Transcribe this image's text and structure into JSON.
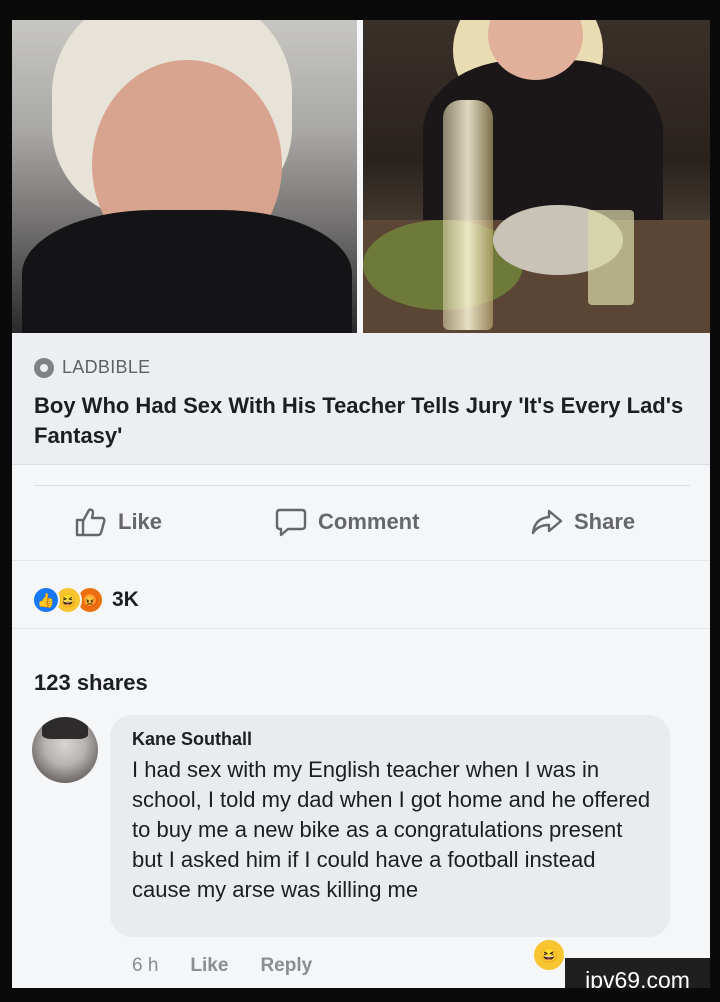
{
  "post": {
    "source": "LADBIBLE",
    "headline": "Boy Who Had Sex With His Teacher Tells Jury 'It's Every Lad's Fantasy'"
  },
  "actions": {
    "like": "Like",
    "comment": "Comment",
    "share": "Share"
  },
  "reactions": {
    "count": "3K",
    "icons": [
      "like-icon",
      "haha-icon",
      "angry-icon"
    ]
  },
  "shares": "123 shares",
  "comment": {
    "author": "Kane Southall",
    "text": "I had sex with my English teacher when I was in school, I told my dad when I got home and he offered to buy me a new bike as a congratulations present but I asked him if I could have a football instead cause my arse was killing me",
    "time": "6 h",
    "like": "Like",
    "reply": "Reply"
  },
  "watermark": "ipv69.com",
  "colors": {
    "like_blue": "#1877f2",
    "haha_yellow": "#f7c631",
    "angry_orange": "#e9710f"
  }
}
